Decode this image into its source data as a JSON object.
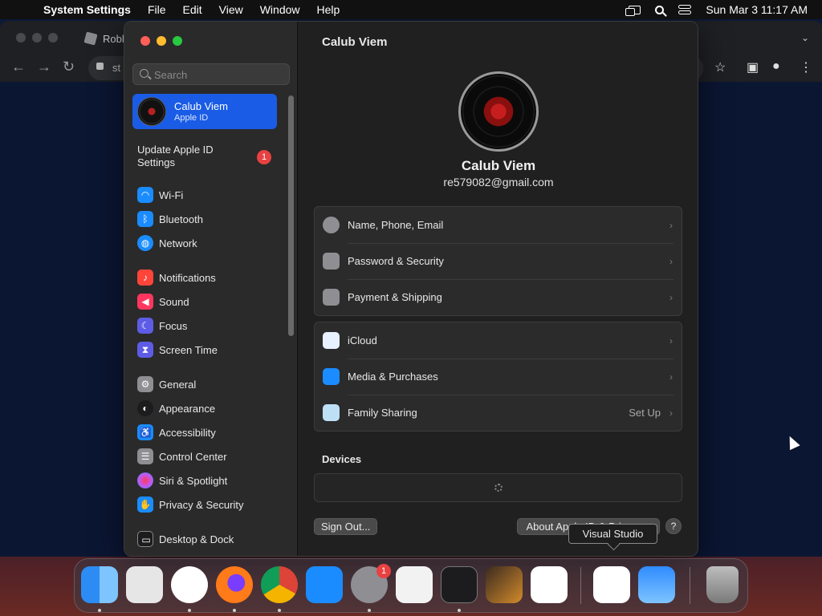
{
  "menubar": {
    "app_name": "System Settings",
    "items": [
      "File",
      "Edit",
      "View",
      "Window",
      "Help"
    ],
    "datetime": "Sun Mar 3  11:17 AM"
  },
  "browser": {
    "tab_label": "Robl",
    "address_partial": "st"
  },
  "sidebar": {
    "search_placeholder": "Search",
    "account": {
      "name": "Calub Viem",
      "subtitle": "Apple ID"
    },
    "update_label": "Update Apple ID Settings",
    "update_badge": "1",
    "items": [
      {
        "label": "Wi-Fi",
        "icon": "wifi-icon",
        "color": "#1a8cff"
      },
      {
        "label": "Bluetooth",
        "icon": "bluetooth-icon",
        "color": "#1a8cff"
      },
      {
        "label": "Network",
        "icon": "globe-icon",
        "color": "#1a8cff"
      },
      {
        "label": "Notifications",
        "icon": "bell-icon",
        "color": "#ff453a"
      },
      {
        "label": "Sound",
        "icon": "speaker-icon",
        "color": "#ff375f"
      },
      {
        "label": "Focus",
        "icon": "moon-icon",
        "color": "#5e5ce6"
      },
      {
        "label": "Screen Time",
        "icon": "hourglass-icon",
        "color": "#5e5ce6"
      },
      {
        "label": "General",
        "icon": "gear-icon",
        "color": "#8e8e93"
      },
      {
        "label": "Appearance",
        "icon": "appearance-icon",
        "color": "#1c1c1e"
      },
      {
        "label": "Accessibility",
        "icon": "accessibility-icon",
        "color": "#1a8cff"
      },
      {
        "label": "Control Center",
        "icon": "control-center-icon",
        "color": "#8e8e93"
      },
      {
        "label": "Siri & Spotlight",
        "icon": "siri-icon",
        "color": "#bf5af2"
      },
      {
        "label": "Privacy & Security",
        "icon": "hand-icon",
        "color": "#1a8cff"
      },
      {
        "label": "Desktop & Dock",
        "icon": "dock-icon",
        "color": "#1c1c1e"
      }
    ]
  },
  "main": {
    "title": "Calub Viem",
    "profile_name": "Calub Viem",
    "email": "re579082@gmail.com",
    "group1": [
      {
        "label": "Name, Phone, Email",
        "icon": "person-icon",
        "color": "#8e8e93"
      },
      {
        "label": "Password & Security",
        "icon": "lock-icon",
        "color": "#8e8e93"
      },
      {
        "label": "Payment & Shipping",
        "icon": "card-icon",
        "color": "#8e8e93"
      }
    ],
    "group2": [
      {
        "label": "iCloud",
        "icon": "icloud-icon",
        "color": "#e8f1ff",
        "value": ""
      },
      {
        "label": "Media & Purchases",
        "icon": "app-store-icon",
        "color": "#1a8cff",
        "value": ""
      },
      {
        "label": "Family Sharing",
        "icon": "family-icon",
        "color": "#bde0f5",
        "value": "Set Up"
      }
    ],
    "devices_title": "Devices",
    "sign_out": "Sign Out...",
    "about": "About Apple ID & Privacy...",
    "help": "?"
  },
  "tooltip": "Visual Studio",
  "dock": {
    "apps": [
      {
        "name": "Finder",
        "icon": "finder-icon",
        "color": "#2c8cf4"
      },
      {
        "name": "Launchpad",
        "icon": "launchpad-icon",
        "color": "#e6e6e6"
      },
      {
        "name": "Safari",
        "icon": "safari-icon",
        "color": "#ffffff"
      },
      {
        "name": "Firefox",
        "icon": "firefox-icon",
        "color": "#ff7a18"
      },
      {
        "name": "Chrome",
        "icon": "chrome-icon",
        "color": "#ffffff"
      },
      {
        "name": "App Store",
        "icon": "app-store-icon",
        "color": "#1a8cff"
      },
      {
        "name": "System Settings",
        "icon": "settings-icon",
        "color": "#8e8e93"
      },
      {
        "name": "TextEdit",
        "icon": "textedit-icon",
        "color": "#f2f2f2"
      },
      {
        "name": "Terminal",
        "icon": "terminal-icon",
        "color": "#1c1c1e"
      },
      {
        "name": "GarageBand",
        "icon": "guitar-icon",
        "color": "#3a2a20"
      },
      {
        "name": "VS Code",
        "icon": "vscode-icon",
        "color": "#ffffff"
      },
      {
        "name": "Visual Studio",
        "icon": "visual-studio-icon",
        "color": "#ffffff"
      },
      {
        "name": "Weather",
        "icon": "weather-icon",
        "color": "#2f8bff"
      },
      {
        "name": "Trash",
        "icon": "trash-icon",
        "color": "#9a9a9a"
      }
    ],
    "settings_badge": "1"
  }
}
